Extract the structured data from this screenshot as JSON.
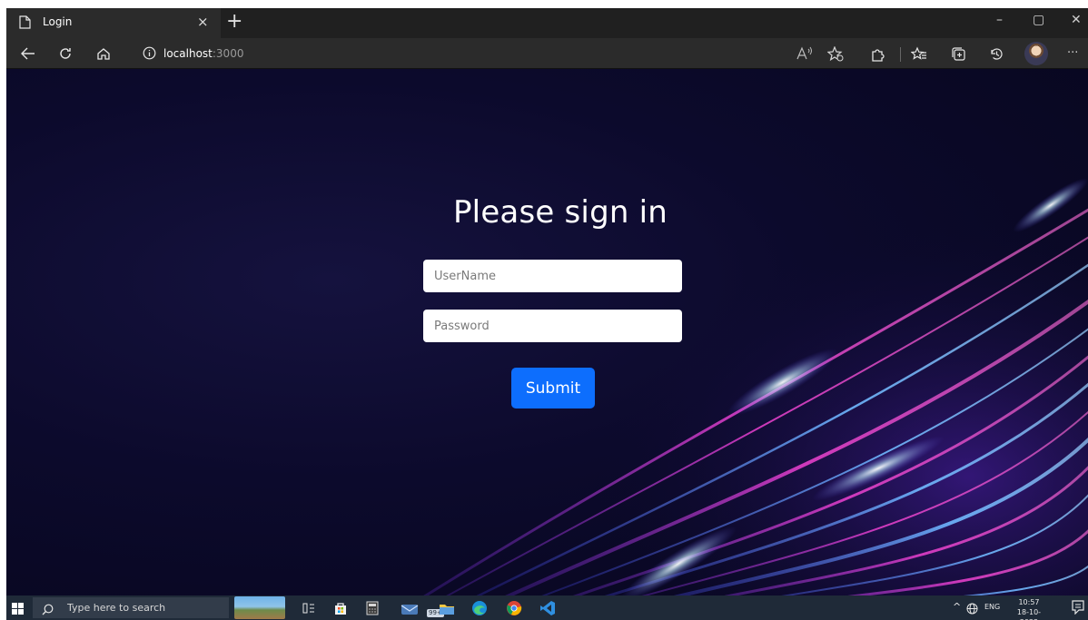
{
  "browser": {
    "tab_title": "Login",
    "tab_close": "×",
    "new_tab": "+",
    "url_host": "localhost",
    "url_port": ":3000",
    "window_controls": {
      "minimize": "–",
      "restore": "▢",
      "close": "✕"
    },
    "more_menu": "···"
  },
  "page": {
    "title": "Please sign in",
    "username_placeholder": "UserName",
    "password_placeholder": "Password",
    "submit_label": "Submit",
    "submit_color": "#0d6efd"
  },
  "taskbar": {
    "search_placeholder": "Type here to search",
    "mail_badge": "99+",
    "tray_chevron": "^",
    "language": "ENG",
    "time": "10:57",
    "date": "18-10-2022"
  },
  "icons": [
    "page-icon",
    "back-icon",
    "refresh-icon",
    "home-icon",
    "info-icon",
    "read-aloud-icon",
    "add-favorite-icon",
    "extensions-icon",
    "favorites-icon",
    "collections-icon",
    "history-icon",
    "windows-icon",
    "search-icon",
    "task-view-icon",
    "store-icon",
    "calculator-icon",
    "mail-icon",
    "file-explorer-icon",
    "edge-icon",
    "chrome-icon",
    "vscode-icon",
    "globe-icon",
    "notification-icon"
  ]
}
